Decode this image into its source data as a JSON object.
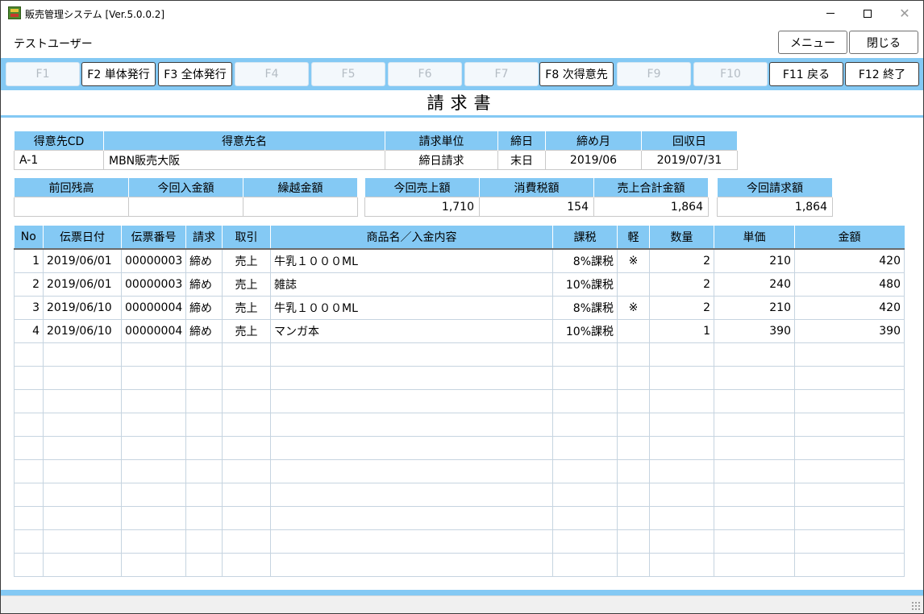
{
  "window": {
    "title": "販売管理システム [Ver.5.0.0.2]"
  },
  "header": {
    "user": "テストユーザー",
    "menu_label": "メニュー",
    "close_label": "閉じる"
  },
  "fkeys": [
    {
      "label": "F1",
      "enabled": false
    },
    {
      "label": "F2 単体発行",
      "enabled": true
    },
    {
      "label": "F3 全体発行",
      "enabled": true
    },
    {
      "label": "F4",
      "enabled": false
    },
    {
      "label": "F5",
      "enabled": false
    },
    {
      "label": "F6",
      "enabled": false
    },
    {
      "label": "F7",
      "enabled": false
    },
    {
      "label": "F8 次得意先",
      "enabled": true
    },
    {
      "label": "F9",
      "enabled": false
    },
    {
      "label": "F10",
      "enabled": false
    },
    {
      "label": "F11 戻る",
      "enabled": true
    },
    {
      "label": "F12 終了",
      "enabled": true
    }
  ],
  "page_title": "請求書",
  "customer": {
    "headers": [
      "得意先CD",
      "得意先名",
      "請求単位",
      "締日",
      "締め月",
      "回収日"
    ],
    "values": [
      "A-1",
      "MBN販売大阪",
      "締日請求",
      "末日",
      "2019/06",
      "2019/07/31"
    ]
  },
  "balance": {
    "headers": [
      "前回残高",
      "今回入金額",
      "繰越金額"
    ],
    "values": [
      "",
      "",
      ""
    ]
  },
  "sales": {
    "headers": [
      "今回売上額",
      "消費税額",
      "売上合計金額"
    ],
    "values": [
      "1,710",
      "154",
      "1,864"
    ]
  },
  "invoice_total": {
    "header": "今回請求額",
    "value": "1,864"
  },
  "details": {
    "headers": [
      "No",
      "伝票日付",
      "伝票番号",
      "請求",
      "取引",
      "商品名／入金内容",
      "課税",
      "軽",
      "数量",
      "単価",
      "金額"
    ],
    "rows": [
      [
        "1",
        "2019/06/01",
        "00000003",
        "締め",
        "売上",
        "牛乳１０００ML",
        "8%課税",
        "※",
        "2",
        "210",
        "420"
      ],
      [
        "2",
        "2019/06/01",
        "00000003",
        "締め",
        "売上",
        "雑誌",
        "10%課税",
        "",
        "2",
        "240",
        "480"
      ],
      [
        "3",
        "2019/06/10",
        "00000004",
        "締め",
        "売上",
        "牛乳１０００ML",
        "8%課税",
        "※",
        "2",
        "210",
        "420"
      ],
      [
        "4",
        "2019/06/10",
        "00000004",
        "締め",
        "売上",
        "マンガ本",
        "10%課税",
        "",
        "1",
        "390",
        "390"
      ]
    ],
    "empty_rows": 10
  },
  "colors": {
    "accent": "#84c9f4",
    "grid_line": "#c6d4e0"
  }
}
